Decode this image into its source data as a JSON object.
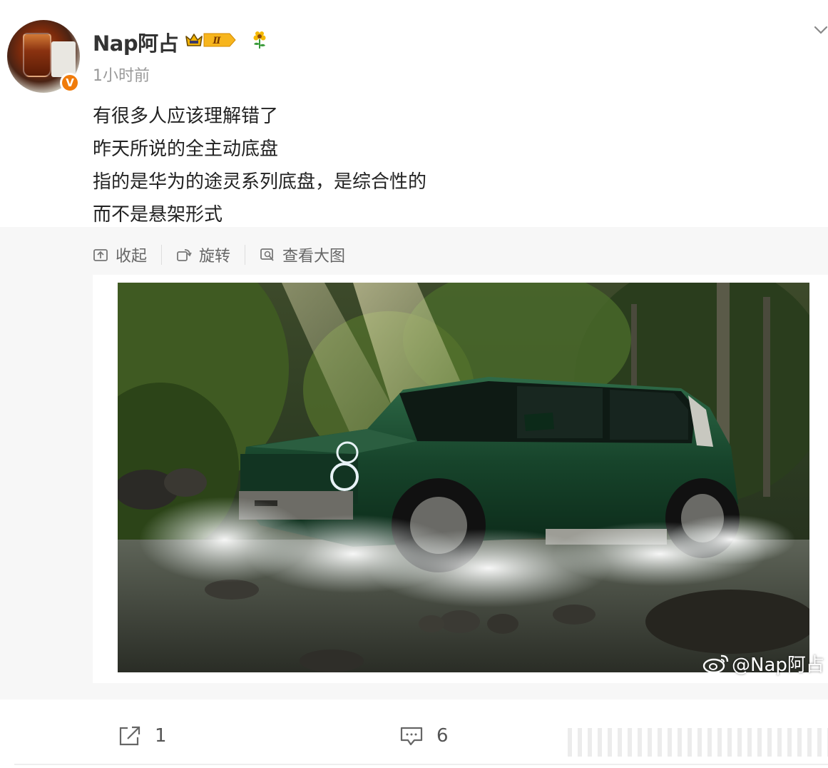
{
  "post": {
    "author": "Nap阿占",
    "time": "1小时前",
    "level": "Ⅱ",
    "verified_mark": "V",
    "lines": [
      "有很多人应该理解错了",
      "昨天所说的全主动底盘",
      "指的是华为的途灵系列底盘，是综合性的",
      "而不是悬架形式"
    ]
  },
  "media_toolbar": {
    "collapse": "收起",
    "rotate": "旋转",
    "view_large": "查看大图"
  },
  "image": {
    "watermark": "@Nap阿占",
    "subject": "green SUV splashing through forest stream"
  },
  "actions": {
    "repost_count": "1",
    "comment_count": "6"
  },
  "icons": [
    "chevron-down-icon",
    "crown-level-badge-icon",
    "flower-icon",
    "collapse-icon",
    "rotate-icon",
    "view-large-icon",
    "weibo-logo-icon",
    "repost-icon",
    "comment-icon"
  ],
  "colors": {
    "accent_orange": "#f07b0a",
    "text_primary": "#333333",
    "text_secondary": "#999999",
    "panel_bg": "#f7f7f7"
  }
}
